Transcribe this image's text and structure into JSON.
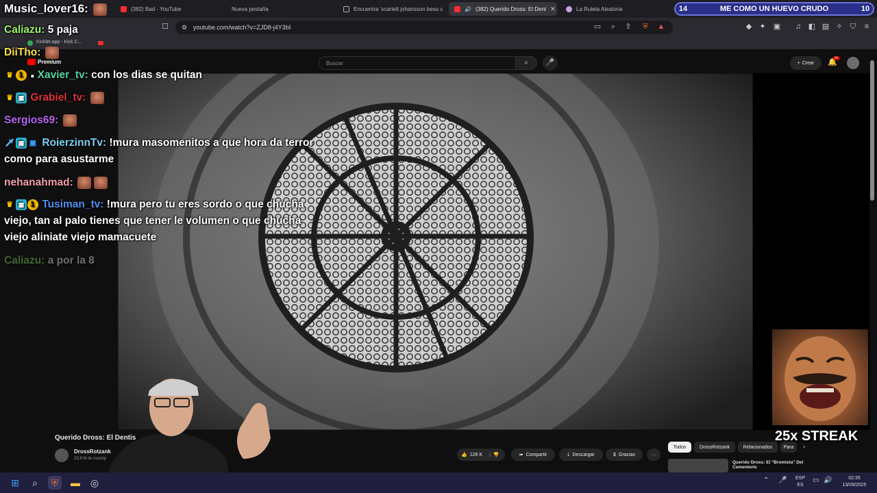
{
  "browser": {
    "tabs": [
      {
        "label": "(382) Bad - YouTube",
        "active": false
      },
      {
        "label": "Nueva pestaña",
        "active": false
      },
      {
        "label": "Encuentra 'scarlett johansson beso c",
        "active": false
      },
      {
        "label": "(382) Querido Dross: El Dent",
        "active": true
      },
      {
        "label": "La Ruleta Aleatoria",
        "active": false
      }
    ],
    "url": "youtube.com/watch?v=ZJD8-j4Y3bI",
    "bookmark": "Kicklet.app - Kick C..."
  },
  "youtube": {
    "premium_label": "Premium",
    "search_placeholder": "Buscar",
    "create_label": "Crear",
    "notif_badge": "9+",
    "video_title": "Querido Dross: El Dentis",
    "channel_name": "DrossRotzank",
    "subscribers": "23,9 M de suscrip",
    "likes": "128 K",
    "share_label": "Compartir",
    "download_label": "Descargar",
    "thanks_label": "Gracias",
    "more_label": "···",
    "chips": [
      "Todos",
      "DrossRotzank",
      "Relacionados",
      "Para"
    ],
    "rec_title": "Querido Dross: El \"Bromista\" Del Cementerio"
  },
  "overlay": {
    "streamer_name": "Music_lover16:",
    "banner": {
      "left_num": "14",
      "label": "ME COMO UN HUEVO CRUDO",
      "right_num": "10"
    },
    "streak": "25x STREAK",
    "chat": [
      {
        "user": "Caliazu:",
        "text": "5 paja",
        "color": "#9cf36b"
      },
      {
        "user": "DiiTho:",
        "text": "",
        "color": "#ffe04a"
      },
      {
        "user": "Xavier_tv:",
        "text": "con los dias se quitan",
        "color": "#57d6a4"
      },
      {
        "user": "Grabiel_tv:",
        "text": "",
        "color": "#e0323c"
      },
      {
        "user": "Sergios69:",
        "text": "",
        "color": "#b766f0"
      },
      {
        "user": "RoierzinnTv:",
        "text": "!mura masomenitos a que hora da terror",
        "text2": "como para asustarme",
        "color": "#7ad0f5"
      },
      {
        "user": "nehanahmad:",
        "text": "",
        "color": "#f0a0a8"
      },
      {
        "user": "Tusiman_tv:",
        "text": "!mura pero tu eres sordo o que chucha",
        "text2": "viejo, tan al palo tienes que tener le volumen o que chucha",
        "text3": "viejo aliniate viejo mamacuete",
        "color": "#4f8ff0"
      },
      {
        "user": "Caliazu:",
        "text": "a por la 8",
        "color": "#4a6b3a",
        "faded": true
      }
    ]
  },
  "taskbar": {
    "lang_top": "ESP",
    "lang_bottom": "ES",
    "time": "02:35",
    "date": "13/09/2025"
  }
}
